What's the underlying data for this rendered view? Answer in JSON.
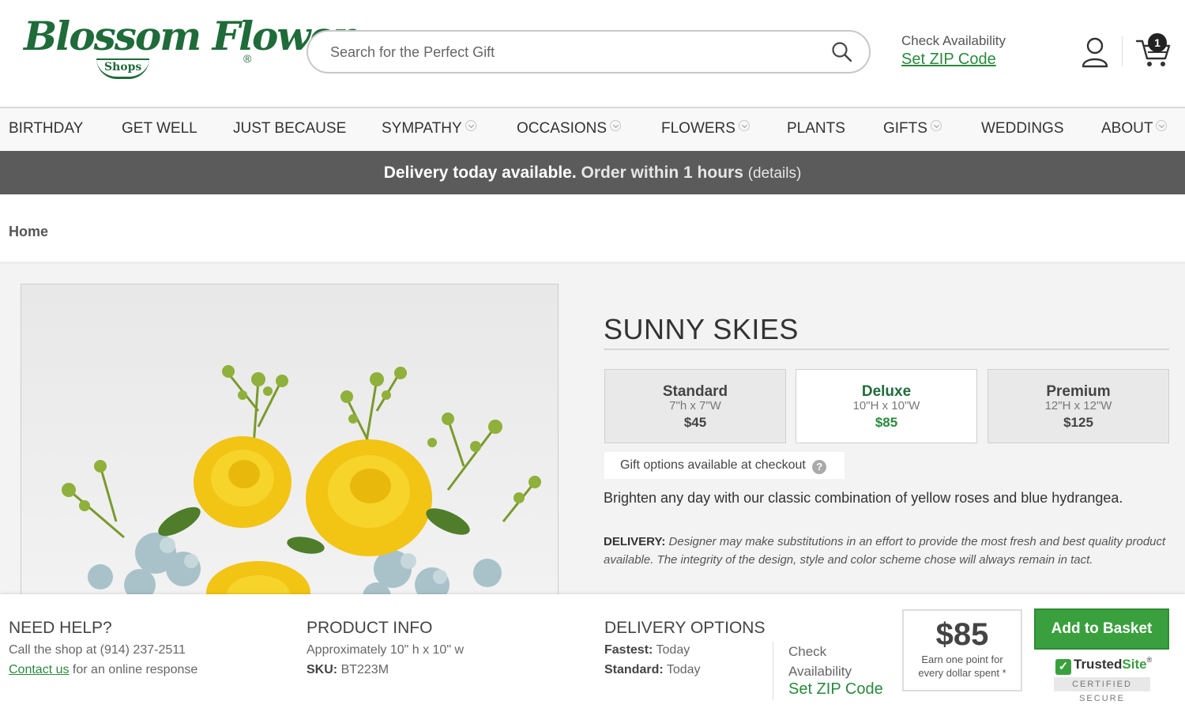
{
  "header": {
    "logo_text": "Blossom Flower",
    "logo_sub": "Shops",
    "logo_reg": "®",
    "search_placeholder": "Search for the Perfect Gift",
    "check_availability": "Check Availability",
    "set_zip": "Set ZIP Code",
    "cart_count": "1",
    "icons": [
      "search-icon",
      "account-icon",
      "cart-icon"
    ]
  },
  "nav": {
    "items": [
      {
        "label": "BIRTHDAY",
        "dropdown": false
      },
      {
        "label": "GET WELL",
        "dropdown": false
      },
      {
        "label": "JUST BECAUSE",
        "dropdown": false
      },
      {
        "label": "SYMPATHY",
        "dropdown": true
      },
      {
        "label": "OCCASIONS",
        "dropdown": true
      },
      {
        "label": "FLOWERS",
        "dropdown": true
      },
      {
        "label": "PLANTS",
        "dropdown": false
      },
      {
        "label": "GIFTS",
        "dropdown": true
      },
      {
        "label": "WEDDINGS",
        "dropdown": false
      },
      {
        "label": "ABOUT",
        "dropdown": true
      }
    ]
  },
  "banner": {
    "bold": "Delivery today available.",
    "order": "Order within 1 hours",
    "details": "(details)",
    "color": "#5b5b5b"
  },
  "breadcrumb": {
    "home": "Home"
  },
  "product": {
    "title": "SUNNY SKIES",
    "sizes": [
      {
        "name": "Standard",
        "dims": "7\"h x 7\"W",
        "price": "$45",
        "selected": false
      },
      {
        "name": "Deluxe",
        "dims": "10\"H x 10\"W",
        "price": "$85",
        "selected": true
      },
      {
        "name": "Premium",
        "dims": "12\"H x 12\"W",
        "price": "$125",
        "selected": false
      }
    ],
    "gift_options": "Gift options available at checkout",
    "gift_help": "?",
    "description": "Brighten any day with our classic combination of yellow roses and blue hydrangea.",
    "delivery_label": "DELIVERY:",
    "delivery_text": "Designer may make substitutions in an effort to provide the most fresh and best quality product available. The integrity of the design, style and color scheme chose will always remain in tact."
  },
  "footer": {
    "help": {
      "title": "NEED HELP?",
      "call": "Call the shop at (914) 237-2511",
      "contact_link": "Contact us",
      "contact_rest": " for an online response"
    },
    "info": {
      "title": "PRODUCT INFO",
      "size": "Approximately 10\" h x 10\" w",
      "sku_label": "SKU:",
      "sku": "BT223M"
    },
    "delivery": {
      "title": "DELIVERY OPTIONS",
      "fastest_label": "Fastest:",
      "fastest": "Today",
      "standard_label": "Standard:",
      "standard": "Today",
      "check": "Check",
      "availability": "Availability",
      "set_zip": "Set ZIP Code"
    },
    "points": {
      "price": "$85",
      "line1": "Earn one point for",
      "line2": "every dollar spent *"
    },
    "add_to_basket": "Add to Basket",
    "trusted_brand_a": "Trusted",
    "trusted_brand_b": "Site",
    "trusted_tm": "®",
    "trusted_sub": "CERTIFIED SECURE"
  },
  "colors": {
    "brand_green": "#1f6b3a",
    "link_green": "#2a8a3e",
    "button_green": "#3aa03e"
  }
}
